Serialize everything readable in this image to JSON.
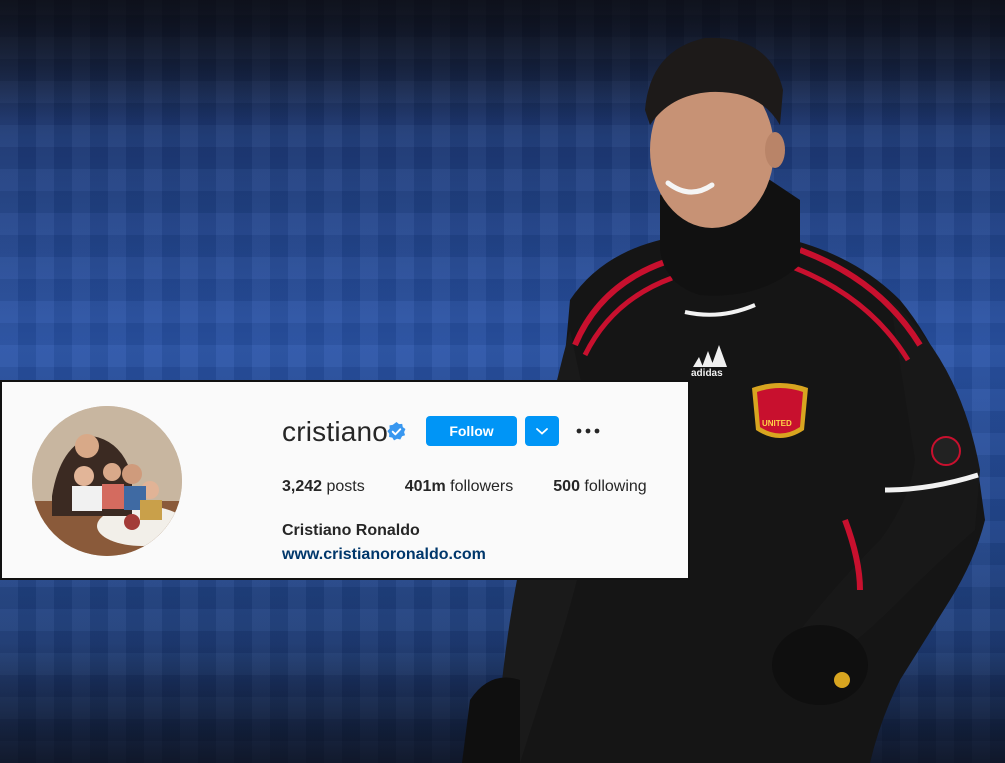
{
  "profile": {
    "username": "cristiano",
    "verified_icon": "verified-badge-icon",
    "follow_label": "Follow",
    "dropdown_icon": "chevron-down-icon",
    "more_icon": "more-options-icon",
    "stats": {
      "posts_count": "3,242",
      "posts_label": "posts",
      "followers_count": "401m",
      "followers_label": "followers",
      "following_count": "500",
      "following_label": "following"
    },
    "full_name": "Cristiano Ronaldo",
    "website": "www.cristianoronaldo.com"
  },
  "photo": {
    "jersey_brand": "adidas",
    "crest_text": "UNITED"
  },
  "colors": {
    "follow_blue": "#0095f6",
    "verified_blue": "#3897f0",
    "link_color": "#00376b",
    "jersey_black": "#151515",
    "jersey_red": "#c8102e"
  }
}
